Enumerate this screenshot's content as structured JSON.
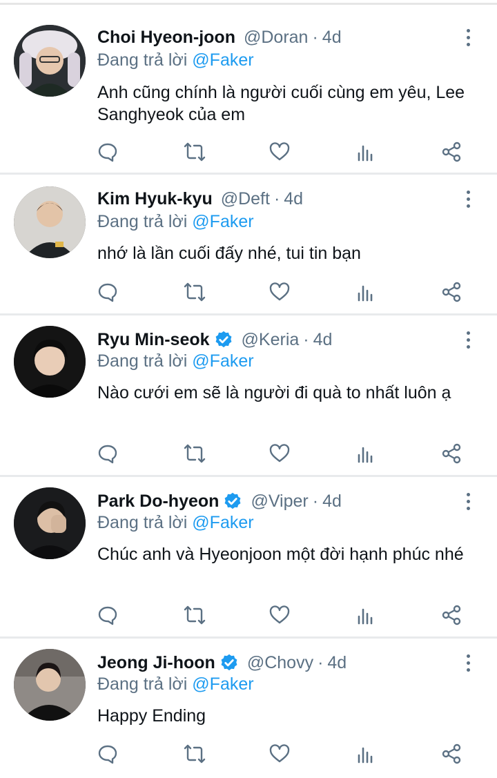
{
  "reply_prefix": "Đang trả lời",
  "tweets": [
    {
      "name": "Choi Hyeon-joon",
      "handle": "@Doran",
      "sep": "·",
      "time": "4d",
      "verified": false,
      "reply_to": "@Faker",
      "text": "Anh cũng chính là người cuối cùng em yêu, Lee Sanghyeok của em",
      "avatar": "avatar-choi"
    },
    {
      "name": "Kim Hyuk-kyu",
      "handle": "@Deft",
      "sep": "·",
      "time": "4d",
      "verified": false,
      "reply_to": "@Faker",
      "text": "nhớ là lần cuối đấy nhé, tui tin bạn",
      "avatar": "avatar-kim"
    },
    {
      "name": "Ryu Min-seok",
      "handle": "@Keria",
      "sep": "·",
      "time": "4d",
      "verified": true,
      "reply_to": "@Faker",
      "text": "Nào cưới em sẽ là người đi quà to nhất luôn ạ",
      "avatar": "avatar-ryu"
    },
    {
      "name": "Park Do-hyeon",
      "handle": "@Viper",
      "sep": "·",
      "time": "4d",
      "verified": true,
      "reply_to": "@Faker",
      "text": "Chúc anh và Hyeonjoon một đời hạnh phúc nhé",
      "avatar": "avatar-park"
    },
    {
      "name": "Jeong Ji-hoon",
      "handle": "@Chovy",
      "sep": "·",
      "time": "4d",
      "verified": true,
      "reply_to": "@Faker",
      "text": "Happy Ending",
      "avatar": "avatar-jeong"
    }
  ],
  "icons": {
    "reply": "reply-icon",
    "retweet": "retweet-icon",
    "like": "like-icon",
    "views": "views-icon",
    "share": "share-icon",
    "more": "more-icon",
    "verified": "verified-badge-icon"
  },
  "colors": {
    "accent": "#1d9bf0",
    "muted": "#5b7083",
    "text": "#0f1419",
    "divider": "#e8eaec"
  }
}
